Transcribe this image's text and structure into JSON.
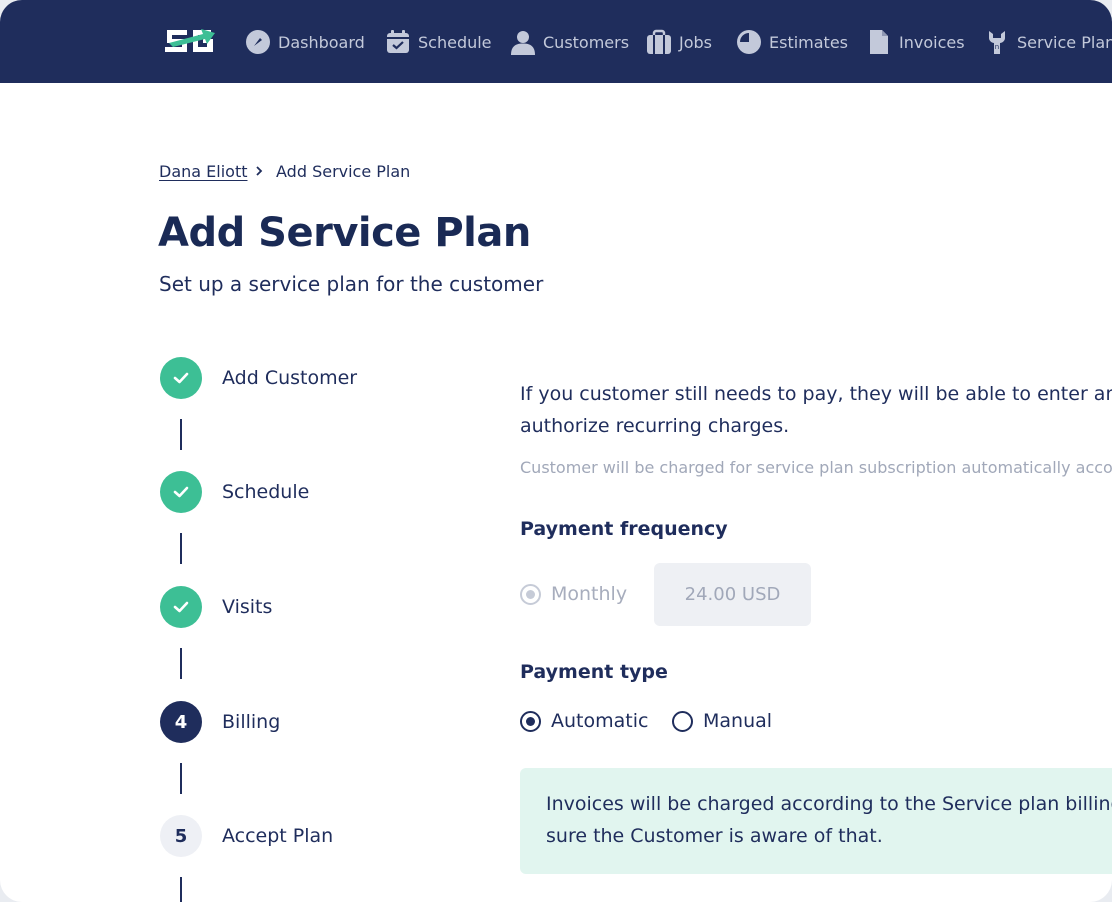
{
  "nav": {
    "items": [
      {
        "label": "Dashboard",
        "icon": "dashboard-gauge-icon"
      },
      {
        "label": "Schedule",
        "icon": "calendar-check-icon"
      },
      {
        "label": "Customers",
        "icon": "user-icon"
      },
      {
        "label": "Jobs",
        "icon": "briefcase-icon"
      },
      {
        "label": "Estimates",
        "icon": "pie-clock-icon"
      },
      {
        "label": "Invoices",
        "icon": "document-icon"
      },
      {
        "label": "Service Plans",
        "icon": "wrench-icon"
      }
    ]
  },
  "breadcrumb": {
    "parent": "Dana Eliott",
    "current": "Add Service Plan"
  },
  "header": {
    "title": "Add Service Plan",
    "subtitle": "Set up a service plan for the customer"
  },
  "steps": [
    {
      "label": "Add Customer",
      "state": "done",
      "number": ""
    },
    {
      "label": "Schedule",
      "state": "done",
      "number": ""
    },
    {
      "label": "Visits",
      "state": "done",
      "number": ""
    },
    {
      "label": "Billing",
      "state": "active",
      "number": "4"
    },
    {
      "label": "Accept Plan",
      "state": "pending",
      "number": "5"
    }
  ],
  "billing": {
    "intro_line1": "If you customer still needs to pay, they will be able to enter and store",
    "intro_line2": "authorize recurring charges.",
    "note": "Customer will be charged for service plan subscription automatically according",
    "frequency": {
      "title": "Payment frequency",
      "option_label": "Monthly",
      "amount": "24.00 USD"
    },
    "payment_type": {
      "title": "Payment type",
      "options": [
        "Automatic",
        "Manual"
      ],
      "selected": "Automatic"
    },
    "info_line1": "Invoices will be charged according to the Service plan billing sche",
    "info_line2": "sure the Customer is aware of that."
  },
  "colors": {
    "nav_bg": "#1f2d5c",
    "accent_green": "#3dbf95",
    "text_primary": "#1f2d5c",
    "info_bg": "#e1f5ef"
  }
}
